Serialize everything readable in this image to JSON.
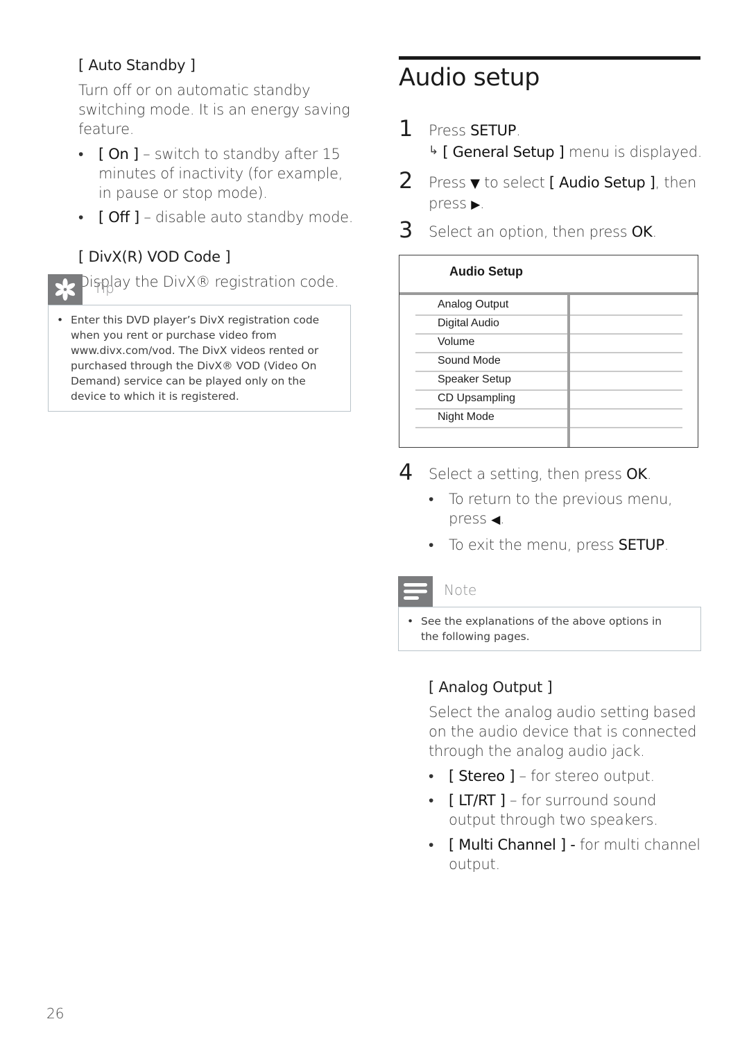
{
  "left": {
    "auto_standby": {
      "heading": "[ Auto Standby ]",
      "description": "Turn off or on automatic standby switching mode. It is an energy saving feature.",
      "options": [
        {
          "label": "[ On ]",
          "text": " – switch to standby after 15 minutes of inactivity (for example, in pause or stop mode)."
        },
        {
          "label": "[ Off ]",
          "text": " – disable auto standby mode."
        }
      ]
    },
    "divx_vod": {
      "heading": "[ DivX(R) VOD Code ]",
      "description": "Display the DivX® registration code."
    },
    "tip": {
      "icon": "asterisk-tip-icon",
      "label": "Tip",
      "items": [
        "Enter this DVD player’s DivX registration code when you rent or purchase video from www.divx.com/vod. The DivX videos rented or purchased through the DivX® VOD (Video On Demand) service can be played only on the device to which it is registered."
      ]
    }
  },
  "right": {
    "title": "Audio setup",
    "steps": [
      {
        "num": "1",
        "pre": "Press ",
        "bold": "SETUP",
        "post": ".",
        "result_arrow": "↳",
        "result_bold": "[ General Setup ]",
        "result_text": " menu is displayed."
      },
      {
        "num": "2",
        "pre": "Press ",
        "sym1": "▼",
        "mid": " to select ",
        "bold": "[ Audio Setup ]",
        "post": ", then press ",
        "sym2": "▶",
        "end": "."
      },
      {
        "num": "3",
        "pre": "Select an option, then press ",
        "bold": "OK",
        "post": "."
      },
      {
        "num": "4",
        "pre": "Select a setting, then press ",
        "bold": "OK",
        "post": "."
      }
    ],
    "step4_bullets": [
      {
        "pre": "To return to the previous menu, press ",
        "sym": "◀",
        "post": "."
      },
      {
        "pre": "To exit the menu, press ",
        "bold": "SETUP",
        "post": "."
      }
    ],
    "menu": {
      "title": "Audio Setup",
      "items": [
        "Analog Output",
        "Digital Audio",
        "Volume",
        "Sound Mode",
        "Speaker Setup",
        "CD Upsampling",
        "Night Mode"
      ]
    },
    "note": {
      "icon": "note-lines-icon",
      "label": "Note",
      "items": [
        "See the explanations of the above options in the following pages."
      ]
    },
    "analog_output": {
      "heading": "[ Analog Output ]",
      "description": "Select the analog audio setting based on the audio device that is connected through the analog audio jack.",
      "options": [
        {
          "label": "[ Stereo ]",
          "text": " – for stereo output."
        },
        {
          "label": "[ LT/RT ]",
          "text": " – for surround sound output through two speakers."
        },
        {
          "label": "[ Multi Channel ]",
          "sep": " - ",
          "text": "for multi channel output."
        }
      ]
    }
  },
  "footer": {
    "page_number": "26"
  }
}
